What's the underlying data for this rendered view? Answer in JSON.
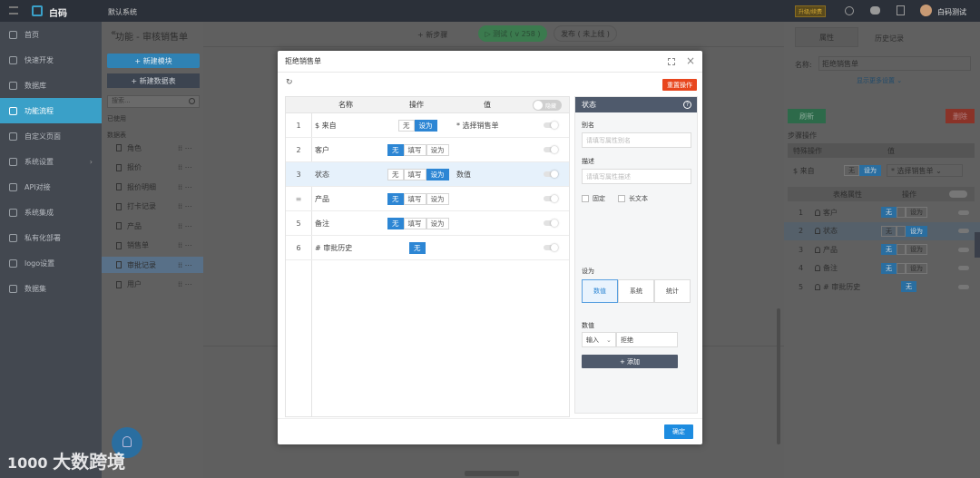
{
  "topbar": {
    "brand": "白码",
    "project": "默认系统",
    "upgrade_badge": "升级/续费",
    "user_name": "白码测试"
  },
  "sidebar": {
    "items": [
      {
        "label": "首页"
      },
      {
        "label": "快速开发"
      },
      {
        "label": "数据库"
      },
      {
        "label": "功能流程"
      },
      {
        "label": "自定义页面"
      },
      {
        "label": "系统设置"
      },
      {
        "label": "API对接"
      },
      {
        "label": "系统集成"
      },
      {
        "label": "私有化部署"
      },
      {
        "label": "logo设置"
      },
      {
        "label": "数据集"
      }
    ]
  },
  "panel2": {
    "new_module": "+ 新建模块",
    "new_table": "+ 新建数据表",
    "search_placeholder": "搜索...",
    "used_label": "已使用",
    "tables_label": "数据表",
    "tables": [
      "角色",
      "报价",
      "报价明细",
      "打卡记录",
      "产品",
      "销售单",
      "审批记录",
      "用户"
    ]
  },
  "main": {
    "title": "功能 - 审核销售单",
    "new_step": "+ 新步骤",
    "test_button": "▷ 测试 ( v 258 )",
    "publish_button": "发布 ( 未上线 )"
  },
  "right": {
    "tab_props": "属性",
    "tab_history": "历史记录",
    "name_label": "名称:",
    "name_value": "拒绝销售单",
    "more_settings": "显示更多设置 ⌄",
    "refresh": "刷新",
    "delete": "删除",
    "step_ops": "步骤操作",
    "special_op": "特殊操作",
    "value_col": "值",
    "source_label": "$ 来自",
    "seg_none": "无",
    "seg_set": "设为",
    "source_select": "* 选择销售单 ⌄",
    "form_attr": "表格属性",
    "ops_col": "操作",
    "fill": "填写",
    "rows": [
      {
        "num": "1",
        "name": "客户"
      },
      {
        "num": "2",
        "name": "状态"
      },
      {
        "num": "3",
        "name": "产品"
      },
      {
        "num": "4",
        "name": "备注"
      },
      {
        "num": "5",
        "name": "# 审批历史"
      }
    ]
  },
  "modal": {
    "title": "拒绝销售单",
    "reset_button": "重置操作",
    "col_name": "名称",
    "col_op": "操作",
    "col_value": "值",
    "header_toggle": "隐藏",
    "seg_none": "无",
    "seg_fill": "填写",
    "seg_set": "设为",
    "rows": [
      {
        "num": "1",
        "name": "$ 来自",
        "value": "* 选择销售单"
      },
      {
        "num": "2",
        "name": "客户",
        "value": ""
      },
      {
        "num": "3",
        "name": "状态",
        "value": "数值"
      },
      {
        "num": "",
        "name": "产品",
        "value": ""
      },
      {
        "num": "5",
        "name": "备注",
        "value": ""
      },
      {
        "num": "6",
        "name": "# 审批历史",
        "value": ""
      }
    ],
    "side": {
      "title": "状态",
      "alias_label": "别名",
      "alias_placeholder": "请填写属性别名",
      "desc_label": "描述",
      "desc_placeholder": "请填写属性描述",
      "fixed_label": "固定",
      "longtext_label": "长文本",
      "setas_label": "设为",
      "opt_value": "数值",
      "opt_system": "系统",
      "opt_stat": "统计",
      "value_label": "数值",
      "input_mode": "输入",
      "input_value": "拒绝",
      "add_button": "+ 添加"
    },
    "ok_button": "确定"
  },
  "watermark": "大数跨境"
}
